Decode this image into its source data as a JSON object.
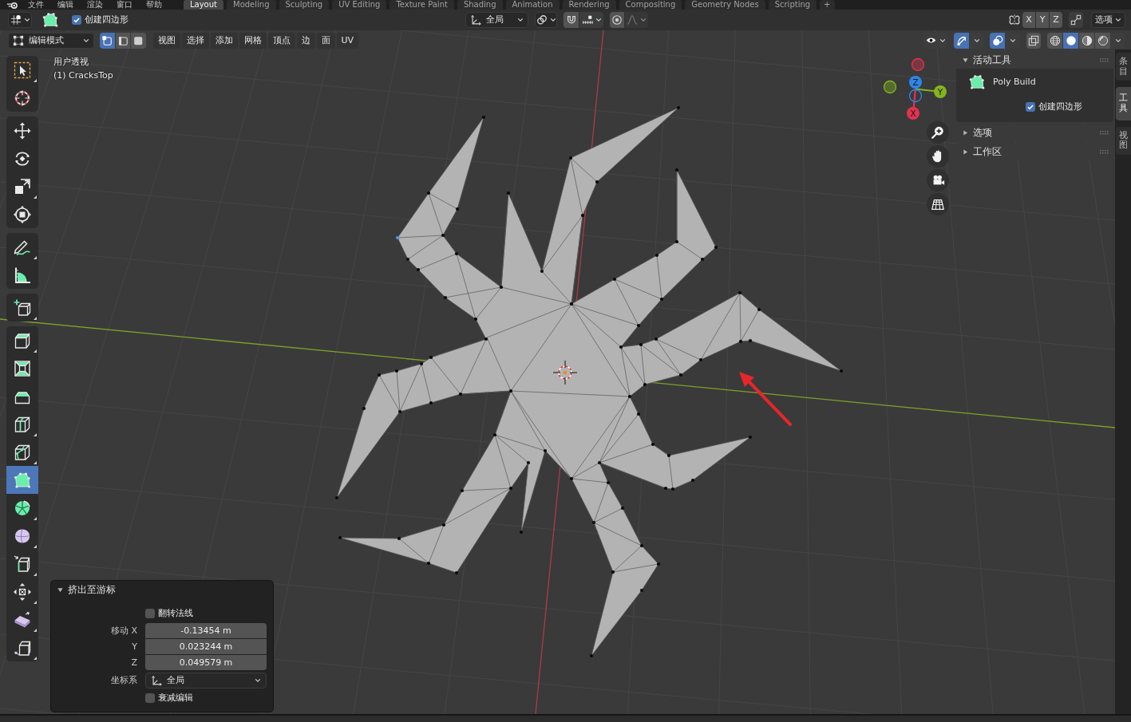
{
  "top_bar": {
    "menus": [
      "文件",
      "编辑",
      "渲染",
      "窗口",
      "帮助"
    ],
    "workspaces": [
      {
        "label": "Layout",
        "selected": true
      },
      {
        "label": "Modeling",
        "selected": false
      },
      {
        "label": "Sculpting",
        "selected": false
      },
      {
        "label": "UV Editing",
        "selected": false
      },
      {
        "label": "Texture Paint",
        "selected": false
      },
      {
        "label": "Shading",
        "selected": false
      },
      {
        "label": "Animation",
        "selected": false
      },
      {
        "label": "Rendering",
        "selected": false
      },
      {
        "label": "Compositing",
        "selected": false
      },
      {
        "label": "Geometry Nodes",
        "selected": false
      },
      {
        "label": "Scripting",
        "selected": false
      }
    ],
    "add_workspace": "+"
  },
  "tool_header": {
    "option": {
      "label": "创建四边形",
      "checked": true
    },
    "orientation": "全局",
    "snap": {
      "on": false
    },
    "proportional_editing": {
      "on": false
    },
    "mirror_axes": [
      {
        "label": "X",
        "on": false
      },
      {
        "label": "Y",
        "on": false
      },
      {
        "label": "Z",
        "on": false
      }
    ],
    "auto_merge": {
      "on": false
    },
    "options_menu": "选项"
  },
  "header": {
    "mode": "编辑模式",
    "select_modes": [
      {
        "kind": "vertex",
        "selected": true
      },
      {
        "kind": "edge",
        "selected": false
      },
      {
        "kind": "face",
        "selected": false
      }
    ],
    "menus": [
      "视图",
      "选择",
      "添加",
      "网格",
      "顶点",
      "边",
      "面",
      "UV"
    ],
    "gizmos": {
      "on": true
    },
    "overlays": {
      "on": true
    },
    "xray": {
      "on": false
    },
    "shading_modes": [
      {
        "kind": "wireframe",
        "selected": false
      },
      {
        "kind": "solid",
        "selected": true
      },
      {
        "kind": "material",
        "selected": false
      },
      {
        "kind": "rendered",
        "selected": false
      }
    ]
  },
  "toolbar": {
    "groups": [
      [
        {
          "kind": "select",
          "selected": false,
          "flyout": true
        },
        {
          "kind": "cursor",
          "selected": false,
          "flyout": false
        }
      ],
      [
        {
          "kind": "move",
          "selected": false,
          "flyout": false
        },
        {
          "kind": "rotate",
          "selected": false,
          "flyout": false
        },
        {
          "kind": "scale",
          "selected": false,
          "flyout": true
        },
        {
          "kind": "transform",
          "selected": false,
          "flyout": false
        }
      ],
      [
        {
          "kind": "annotate",
          "selected": false,
          "flyout": true
        },
        {
          "kind": "measure",
          "selected": false,
          "flyout": false
        }
      ],
      [
        {
          "kind": "addcube",
          "selected": false,
          "flyout": true
        }
      ],
      [
        {
          "kind": "extrude",
          "selected": false,
          "flyout": true
        },
        {
          "kind": "inset",
          "selected": false,
          "flyout": false
        },
        {
          "kind": "bevel",
          "selected": false,
          "flyout": false
        },
        {
          "kind": "loopcut",
          "selected": false,
          "flyout": true
        },
        {
          "kind": "knife",
          "selected": false,
          "flyout": true
        },
        {
          "kind": "polybuild",
          "selected": true,
          "flyout": false
        },
        {
          "kind": "spin",
          "selected": false,
          "flyout": true
        },
        {
          "kind": "smooth",
          "selected": false,
          "flyout": true
        },
        {
          "kind": "edgeslide",
          "selected": false,
          "flyout": true
        },
        {
          "kind": "shrink",
          "selected": false,
          "flyout": true
        },
        {
          "kind": "shear",
          "selected": false,
          "flyout": true
        },
        {
          "kind": "rip",
          "selected": false,
          "flyout": true
        }
      ]
    ]
  },
  "viewport": {
    "view_name": "用户透视",
    "object_name": "(1) CracksTop",
    "navigation_gizmo": {
      "axes": [
        {
          "label": "X",
          "color": "#e2334f"
        },
        {
          "label": "Y",
          "color": "#84b41f"
        },
        {
          "label": "Z",
          "color": "#2e86e8"
        }
      ]
    }
  },
  "sidebar": {
    "panels": [
      {
        "title": "活动工具",
        "expanded": true,
        "tool_name": "Poly Build",
        "option": {
          "label": "创建四边形",
          "checked": true
        }
      },
      {
        "title": "选项",
        "expanded": false
      },
      {
        "title": "工作区",
        "expanded": false
      }
    ],
    "tabs": [
      {
        "label": "条目",
        "selected": false
      },
      {
        "label": "工具",
        "selected": true
      },
      {
        "label": "视图",
        "selected": false
      }
    ]
  },
  "operator_panel": {
    "title": "挤出至游标",
    "expanded": true,
    "rows": [
      {
        "kind": "checkbox",
        "label": "翻转法线",
        "checked": false
      },
      {
        "kind": "number",
        "label": "移动 X",
        "value": "-0.13454 m"
      },
      {
        "kind": "number",
        "label": "Y",
        "value": "0.023244 m"
      },
      {
        "kind": "number",
        "label": "Z",
        "value": "0.049579 m"
      },
      {
        "kind": "dropdown",
        "label": "坐标系",
        "value": "全局"
      },
      {
        "kind": "checkbox",
        "label": "衰减编辑",
        "checked": false
      }
    ]
  }
}
